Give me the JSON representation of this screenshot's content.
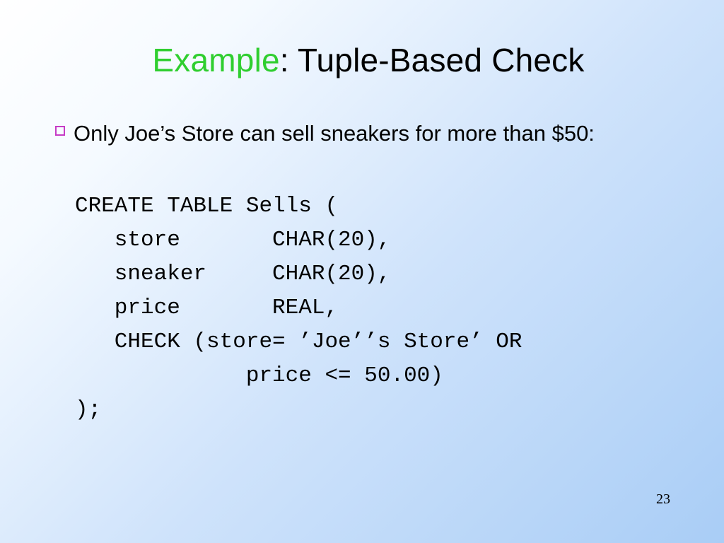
{
  "title": {
    "accent": "Example",
    "rest": ": Tuple-Based Check"
  },
  "bullet": "Only Joe’s Store can sell sneakers for more than $50:",
  "code": {
    "l1": "CREATE TABLE Sells (",
    "l2": "   store       CHAR(20),",
    "l3": "   sneaker     CHAR(20),",
    "l4": "   price       REAL,",
    "l5": "   CHECK (store= ’Joe’’s Store’ OR",
    "l6": "             price <= 50.00)",
    "l7": ");"
  },
  "page_number": "23"
}
